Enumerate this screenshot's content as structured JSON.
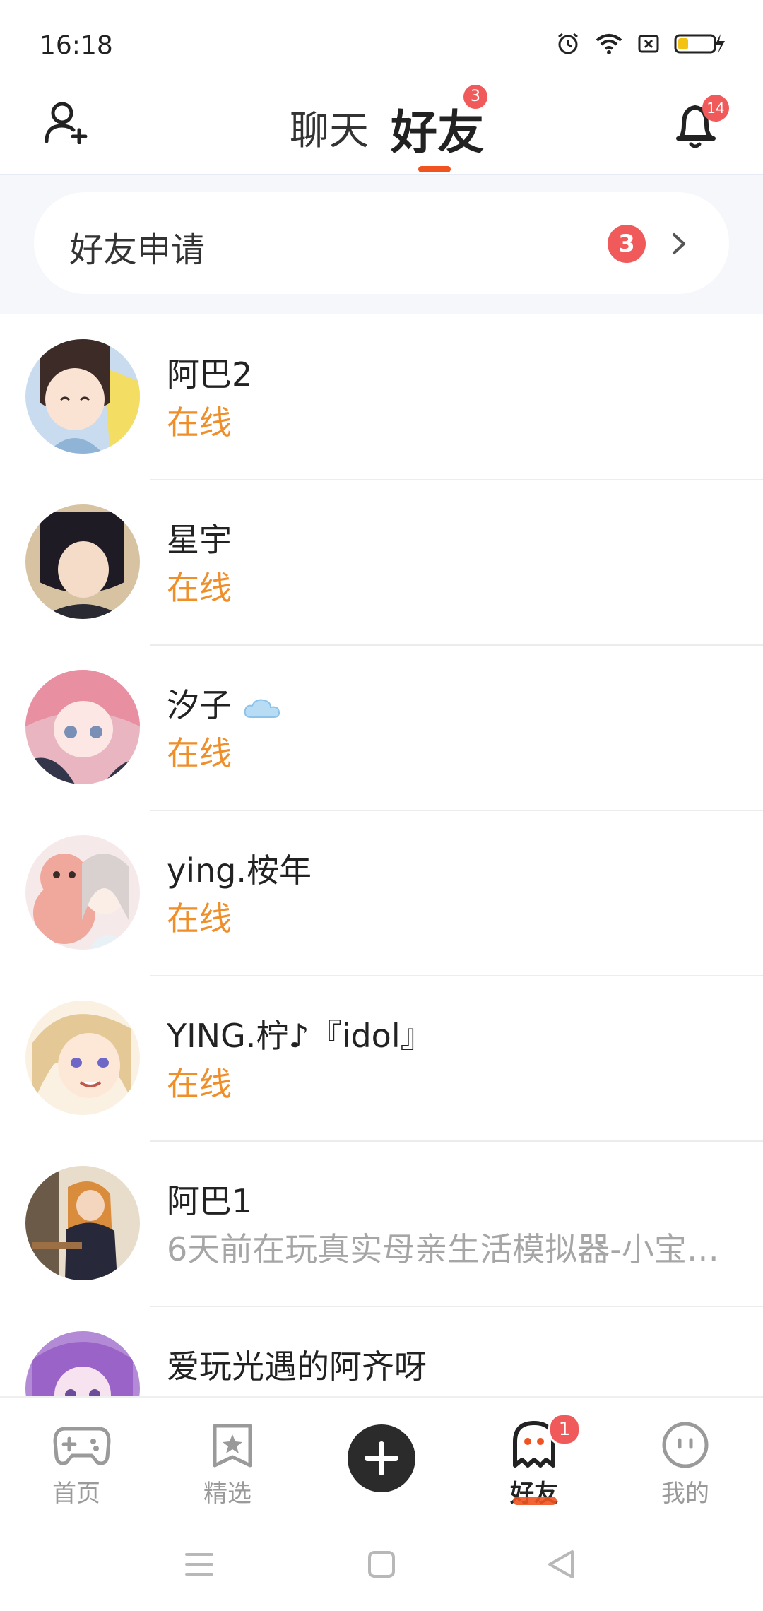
{
  "status_bar": {
    "time": "16:18"
  },
  "header": {
    "tabs": [
      {
        "label": "聊天",
        "active": false
      },
      {
        "label": "好友",
        "active": true,
        "badge": "3"
      }
    ],
    "notification_badge": "14"
  },
  "friend_request": {
    "label": "好友申请",
    "count": "3"
  },
  "friends": [
    {
      "name": "阿巴2",
      "status": "在线",
      "online": true
    },
    {
      "name": "星宇",
      "status": "在线",
      "online": true
    },
    {
      "name": "汐子",
      "status": "在线",
      "online": true
    },
    {
      "name": "ying.桉年",
      "status": "在线",
      "online": true
    },
    {
      "name": "YING.柠♪『idol』",
      "status": "在线",
      "online": true
    },
    {
      "name": "阿巴1",
      "status": "6天前在玩真实母亲生活模拟器-小宝…",
      "online": false
    },
    {
      "name": "爱玩光遇的阿齐呀",
      "status": "",
      "online": false
    }
  ],
  "bottom_nav": {
    "items": [
      {
        "label": "首页",
        "icon": "gamepad-icon",
        "active": false
      },
      {
        "label": "精选",
        "icon": "star-bookmark-icon",
        "active": false
      },
      {
        "label": "",
        "icon": "plus-icon",
        "active": false
      },
      {
        "label": "好友",
        "icon": "ghost-icon",
        "active": true,
        "badge": "1"
      },
      {
        "label": "我的",
        "icon": "face-icon",
        "active": false
      }
    ]
  },
  "colors": {
    "accent": "#f0531f",
    "online": "#ee8f2a",
    "badge": "#f05a5a"
  }
}
